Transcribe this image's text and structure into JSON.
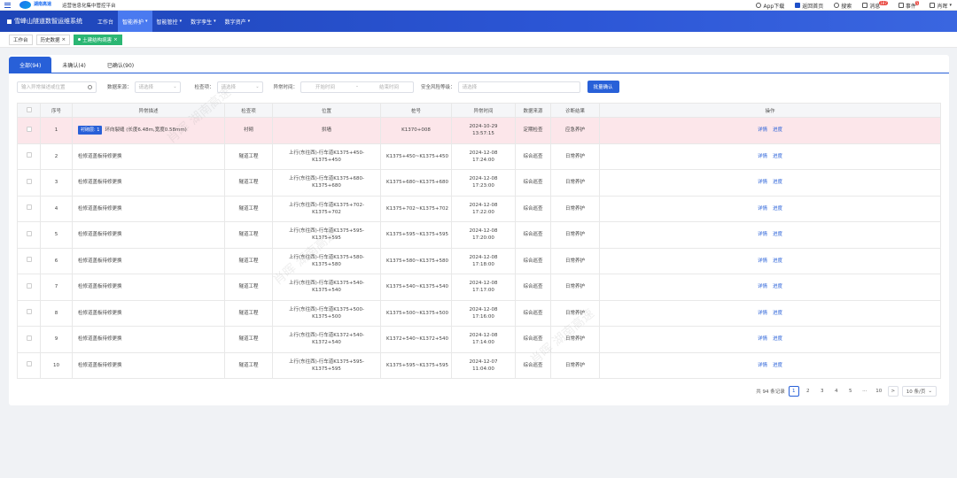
{
  "header": {
    "logo_text": "湖南高速",
    "platform": "运营信息化集中管控平台",
    "app_download": "App下载",
    "home": "返回首页",
    "search": "搜索",
    "messages": "消息",
    "messages_badge": "187",
    "todo": "事件",
    "todo_badge": "5",
    "user": "肖晖"
  },
  "nav": {
    "system_name": "雪峰山隧道数智运维系统",
    "items": [
      {
        "label": "工作台"
      },
      {
        "label": "智能养护"
      },
      {
        "label": "智能管控"
      },
      {
        "label": "数字孪生"
      },
      {
        "label": "数字资产"
      }
    ]
  },
  "page_tabs": [
    {
      "label": "工作台"
    },
    {
      "label": "历史数据"
    },
    {
      "label": "土建结构病害"
    }
  ],
  "filter_tabs": [
    {
      "label": "全部(94)"
    },
    {
      "label": "未确认(4)"
    },
    {
      "label": "已确认(90)"
    }
  ],
  "filters": {
    "search_placeholder": "输入异常描述或位置",
    "source_label": "数据来源：",
    "source_placeholder": "请选择",
    "check_label": "检查项：",
    "check_placeholder": "请选择",
    "time_label": "异常时间：",
    "time_start_placeholder": "开始时间",
    "time_sep": "-",
    "time_end_placeholder": "结束时间",
    "risk_label": "安全风险等级：",
    "risk_placeholder": "请选择",
    "batch_confirm": "批量确认"
  },
  "table": {
    "headers": [
      "",
      "序号",
      "异常描述",
      "检查项",
      "位置",
      "桩号",
      "异常时间",
      "数据来源",
      "诊断结果",
      "操作"
    ],
    "op_detail": "详情",
    "op_progress": "进度",
    "rows": [
      {
        "no": "1",
        "tag": "衬砌层: 1",
        "desc": "环向裂缝 (长度6.48m,宽度0.58mm)",
        "check": "衬砌",
        "pos": "拱墙",
        "stake": "K1370+008",
        "time": "2024-10-29 13:57:15",
        "source": "定期检查",
        "result": "应急养护"
      },
      {
        "no": "2",
        "tag": "",
        "desc": "检修道盖板待修更换",
        "check": "隧道工程",
        "pos": "上行(东往西)-行车道K1375+450-K1375+450",
        "stake": "K1375+450~K1375+450",
        "time": "2024-12-08 17:24:00",
        "source": "综合巡查",
        "result": "日常养护"
      },
      {
        "no": "3",
        "tag": "",
        "desc": "检修道盖板待修更换",
        "check": "隧道工程",
        "pos": "上行(东往西)-行车道K1375+680-K1375+680",
        "stake": "K1375+680~K1375+680",
        "time": "2024-12-08 17:23:00",
        "source": "综合巡查",
        "result": "日常养护"
      },
      {
        "no": "4",
        "tag": "",
        "desc": "检修道盖板待修更换",
        "check": "隧道工程",
        "pos": "上行(东往西)-行车道K1375+702-K1375+702",
        "stake": "K1375+702~K1375+702",
        "time": "2024-12-08 17:22:00",
        "source": "综合巡查",
        "result": "日常养护"
      },
      {
        "no": "5",
        "tag": "",
        "desc": "检修道盖板待修更换",
        "check": "隧道工程",
        "pos": "上行(东往西)-行车道K1375+595-K1375+595",
        "stake": "K1375+595~K1375+595",
        "time": "2024-12-08 17:20:00",
        "source": "综合巡查",
        "result": "日常养护"
      },
      {
        "no": "6",
        "tag": "",
        "desc": "检修道盖板待修更换",
        "check": "隧道工程",
        "pos": "上行(东往西)-行车道K1375+580-K1375+580",
        "stake": "K1375+580~K1375+580",
        "time": "2024-12-08 17:18:00",
        "source": "综合巡查",
        "result": "日常养护"
      },
      {
        "no": "7",
        "tag": "",
        "desc": "检修道盖板待修更换",
        "check": "隧道工程",
        "pos": "上行(东往西)-行车道K1375+540-K1375+540",
        "stake": "K1375+540~K1375+540",
        "time": "2024-12-08 17:17:00",
        "source": "综合巡查",
        "result": "日常养护"
      },
      {
        "no": "8",
        "tag": "",
        "desc": "检修道盖板待修更换",
        "check": "隧道工程",
        "pos": "上行(东往西)-行车道K1375+500-K1375+500",
        "stake": "K1375+500~K1375+500",
        "time": "2024-12-08 17:16:00",
        "source": "综合巡查",
        "result": "日常养护"
      },
      {
        "no": "9",
        "tag": "",
        "desc": "检修道盖板待修更换",
        "check": "隧道工程",
        "pos": "上行(东往西)-行车道K1372+540-K1372+540",
        "stake": "K1372+540~K1372+540",
        "time": "2024-12-08 17:14:00",
        "source": "综合巡查",
        "result": "日常养护"
      },
      {
        "no": "10",
        "tag": "",
        "desc": "检修道盖板待修更换",
        "check": "隧道工程",
        "pos": "上行(东往西)-行车道K1375+595-K1375+595",
        "stake": "K1375+595~K1375+595",
        "time": "2024-12-07 11:04:00",
        "source": "综合巡查",
        "result": "日常养护"
      }
    ]
  },
  "pagination": {
    "total": "共 94 条记录",
    "pages": [
      "1",
      "2",
      "3",
      "4",
      "5"
    ],
    "ellipsis": "···",
    "last": "10",
    "prev": "<",
    "next": ">",
    "page_size": "10 条/页"
  },
  "watermark": "肖晖 湖南高速"
}
